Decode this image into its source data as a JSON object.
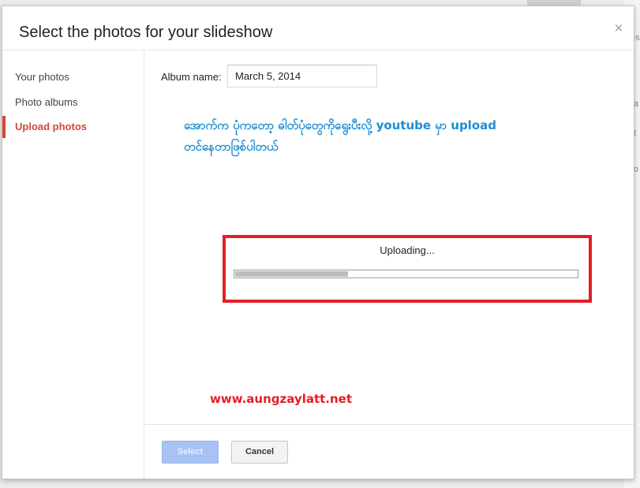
{
  "dialog": {
    "title": "Select the photos for your slideshow",
    "close_glyph": "×"
  },
  "sidebar": {
    "items": [
      {
        "label": "Your photos",
        "active": false
      },
      {
        "label": "Photo albums",
        "active": false
      },
      {
        "label": "Upload photos",
        "active": true
      }
    ]
  },
  "album": {
    "label": "Album name:",
    "value": "March 5, 2014"
  },
  "annotation": {
    "line1": "အောက်က ပုံကတော့ ဓါတ်ပုံတွေကိုရွေးပီးလို့ youtube မှာ upload",
    "line2": "တင်နေတာဖြစ်ပါတယ်",
    "color": "#1a8fd6"
  },
  "upload": {
    "status": "Uploading...",
    "progress": 0.33,
    "highlight_color": "#e41e26"
  },
  "watermark": "www.aungzaylatt.net",
  "footer": {
    "select_label": "Select",
    "cancel_label": "Cancel"
  },
  "background": {
    "fragments": [
      "es",
      "a",
      "t",
      "o"
    ]
  },
  "colors": {
    "accent": "#d14836",
    "primary_button": "#a7c2f3"
  }
}
